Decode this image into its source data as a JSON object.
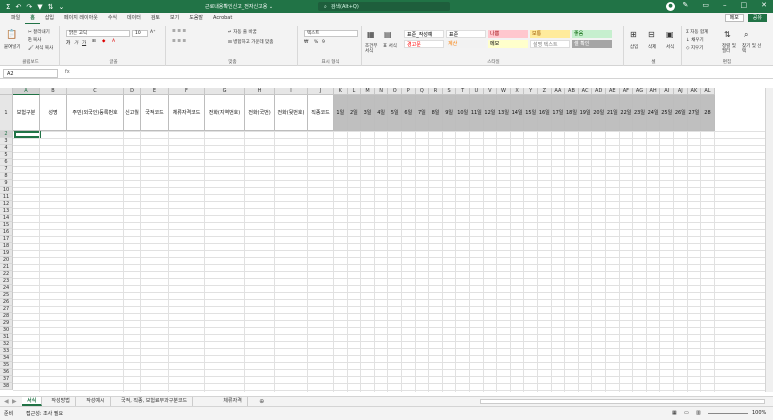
{
  "title_bar": {
    "doc_title": "근로내용확인신고_전자신고용 ⌄",
    "search_placeholder": "검색(Alt+Q)",
    "user_initial": "●"
  },
  "ribbon_tabs": [
    "파일",
    "홈",
    "삽입",
    "페이지 레이아웃",
    "수식",
    "데이터",
    "검토",
    "보기",
    "도움말",
    "Acrobat"
  ],
  "active_tab": "홈",
  "share": {
    "memo": "메모",
    "share": "공유"
  },
  "ribbon": {
    "clipboard": {
      "label": "클립보드",
      "paste": "붙여넣기",
      "cut": "잘라내기",
      "copy": "복사",
      "format_painter": "서식 복사"
    },
    "font": {
      "label": "글꼴",
      "font_name": "맑은 고딕",
      "font_size": "10",
      "bold": "가",
      "italic": "가",
      "underline": "가"
    },
    "align": {
      "label": "맞춤",
      "wrap": "자동 줄 바꿈",
      "merge": "병합하고 가운데 맞춤"
    },
    "number": {
      "label": "표시 형식",
      "format": "텍스트",
      "percent": "%",
      "comma": "9"
    },
    "styles": {
      "label": "스타일",
      "cond_format": "조건부 서식",
      "table_format": "표 서식",
      "cells": [
        {
          "text": "표준_작성예",
          "bg": "#ffffff",
          "fg": "#000000"
        },
        {
          "text": "표준",
          "bg": "#ffffff",
          "fg": "#000000"
        },
        {
          "text": "나쁨",
          "bg": "#ffc7ce",
          "fg": "#9c0006"
        },
        {
          "text": "보통",
          "bg": "#ffeb9c",
          "fg": "#9c5700"
        },
        {
          "text": "좋음",
          "bg": "#c6efce",
          "fg": "#006100"
        },
        {
          "text": "경고문",
          "bg": "#ffffff",
          "fg": "#ff0000"
        },
        {
          "text": "계산",
          "bg": "#f2f2f2",
          "fg": "#fa7d00"
        },
        {
          "text": "메모",
          "bg": "#ffffcc",
          "fg": "#000000"
        },
        {
          "text": "설명 텍스트",
          "bg": "#ffffff",
          "fg": "#7f7f7f"
        },
        {
          "text": "셀 확인",
          "bg": "#a5a5a5",
          "fg": "#ffffff"
        }
      ]
    },
    "cells": {
      "label": "셀",
      "insert": "삽입",
      "delete": "삭제",
      "format": "서식"
    },
    "edit": {
      "label": "편집",
      "autosum": "자동 합계",
      "fill": "채우기",
      "clear": "지우기",
      "sort": "정렬 및 필터",
      "find": "찾기 및 선택"
    }
  },
  "formula_bar": {
    "name_box": "A2",
    "fx": "fx"
  },
  "columns": [
    "A",
    "B",
    "C",
    "D",
    "E",
    "F",
    "G",
    "H",
    "I",
    "J",
    "K",
    "L",
    "M",
    "N",
    "O",
    "P",
    "Q",
    "R",
    "S",
    "T",
    "U",
    "V",
    "W",
    "X",
    "Y",
    "Z",
    "AA",
    "AB",
    "AC",
    "AD",
    "AE",
    "AF",
    "AG",
    "AH",
    "AI",
    "AJ",
    "AK",
    "AL"
  ],
  "header_row": [
    "보험구분",
    "성명",
    "주민(외국인)등록번호",
    "신고월",
    "국적코드",
    "체류자격코드",
    "전화(지역번호)",
    "전화(국번)",
    "전화(뒷번호)",
    "직종코드",
    "1일",
    "2일",
    "3일",
    "4일",
    "5일",
    "6일",
    "7일",
    "8일",
    "9일",
    "10일",
    "11일",
    "12일",
    "13일",
    "14일",
    "15일",
    "16일",
    "17일",
    "18일",
    "19일",
    "20일",
    "21일",
    "22일",
    "23일",
    "24일",
    "25일",
    "26일",
    "27일",
    "28"
  ],
  "row_numbers": [
    "1",
    "2",
    "3",
    "4",
    "5",
    "6",
    "7",
    "8",
    "9",
    "10",
    "11",
    "12",
    "13",
    "14",
    "15",
    "16",
    "17",
    "18",
    "19",
    "20",
    "21",
    "22",
    "23",
    "24",
    "25",
    "26",
    "27",
    "28",
    "29",
    "30",
    "31",
    "32",
    "33",
    "34",
    "35",
    "36",
    "37",
    "38"
  ],
  "sheet_tabs": [
    "서식",
    "작성방법",
    "작성예시",
    "국적, 직종, 보험료부과구분코드",
    "체류자격"
  ],
  "active_sheet": "서식",
  "status": {
    "ready": "준비",
    "accessibility": "접근성: 조사 필요",
    "zoom": "100%"
  },
  "colors": {
    "accent": "#217346",
    "header_gray": "#bfbfbf"
  }
}
